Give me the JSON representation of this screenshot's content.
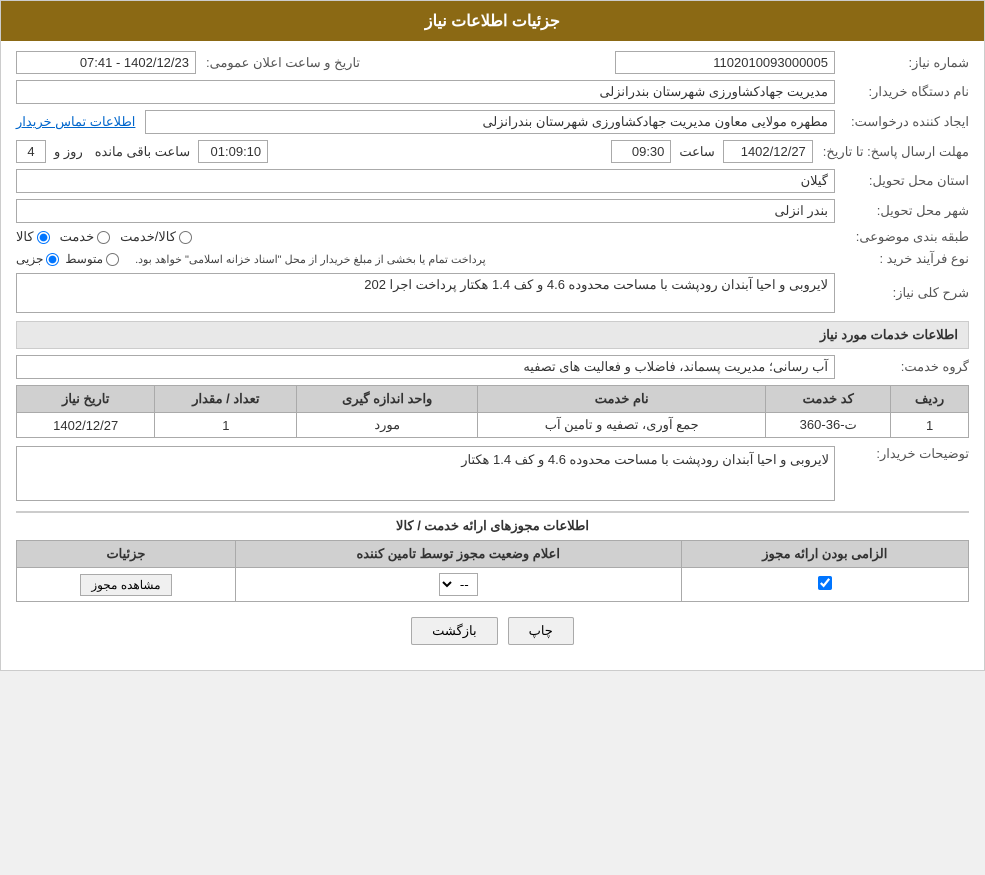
{
  "header": {
    "title": "جزئیات اطلاعات نیاز"
  },
  "fields": {
    "need_number_label": "شماره نیاز:",
    "need_number_value": "1102010093000005",
    "announce_time_label": "تاریخ و ساعت اعلان عمومی:",
    "announce_time_value": "1402/12/23 - 07:41",
    "buyer_name_label": "نام دستگاه خریدار:",
    "buyer_name_value": "مدیریت جهادکشاورزی شهرستان بندرانزلی",
    "creator_label": "ایجاد کننده درخواست:",
    "creator_value": "مطهره مولایی معاون مدیریت جهادکشاورزی شهرستان بندرانزلی",
    "contact_info_link": "اطلاعات تماس خریدار",
    "deadline_label": "مهلت ارسال پاسخ: تا تاریخ:",
    "deadline_date": "1402/12/27",
    "deadline_time_label": "ساعت",
    "deadline_time": "09:30",
    "deadline_days_label": "روز و",
    "deadline_days": "4",
    "deadline_remaining_label": "ساعت باقی مانده",
    "deadline_remaining": "01:09:10",
    "province_label": "استان محل تحویل:",
    "province_value": "گیلان",
    "city_label": "شهر محل تحویل:",
    "city_value": "بندر انزلی",
    "category_label": "طبقه بندی موضوعی:",
    "category_kala": "کالا",
    "category_khedmat": "خدمت",
    "category_kala_khedmat": "کالا/خدمت",
    "process_type_label": "نوع فرآیند خرید :",
    "process_jozvi": "جزیی",
    "process_motavasset": "متوسط",
    "process_note": "پرداخت تمام یا بخشی از مبلغ خریدار از محل \"اسناد خزانه اسلامی\" خواهد بود.",
    "need_description_label": "شرح کلی نیاز:",
    "need_description_value": "لایروبی و احیا آبندان رودپشت با مساحت محدوده 4.6 و کف 1.4 هکتار پرداخت اجرا 202",
    "service_info_title": "اطلاعات خدمات مورد نیاز",
    "service_group_label": "گروه خدمت:",
    "service_group_value": "آب رسانی؛ مدیریت پسماند، فاضلاب و فعالیت های تصفیه",
    "table_headers": {
      "row_num": "ردیف",
      "service_code": "کد خدمت",
      "service_name": "نام خدمت",
      "unit": "واحد اندازه گیری",
      "quantity": "تعداد / مقدار",
      "need_date": "تاریخ نیاز"
    },
    "table_rows": [
      {
        "row_num": "1",
        "service_code": "ت-36-360",
        "service_name": "جمع آوری، تصفیه و تامین آب",
        "unit": "مورد",
        "quantity": "1",
        "need_date": "1402/12/27"
      }
    ],
    "buyer_desc_label": "توضیحات خریدار:",
    "buyer_desc_value": "لایروبی و احیا آبندان رودپشت با مساحت محدوده 4.6 و کف 1.4 هکتار",
    "permissions_title": "اطلاعات مجوزهای ارائه خدمت / کالا",
    "permissions_table_headers": {
      "mandatory": "الزامی بودن ارائه مجوز",
      "status": "اعلام وضعیت مجوز توسط تامین کننده",
      "details": "جزئیات"
    },
    "permissions_rows": [
      {
        "mandatory": true,
        "status": "--",
        "show_btn": "مشاهده مجوز"
      }
    ]
  },
  "buttons": {
    "print": "چاپ",
    "back": "بازگشت"
  }
}
